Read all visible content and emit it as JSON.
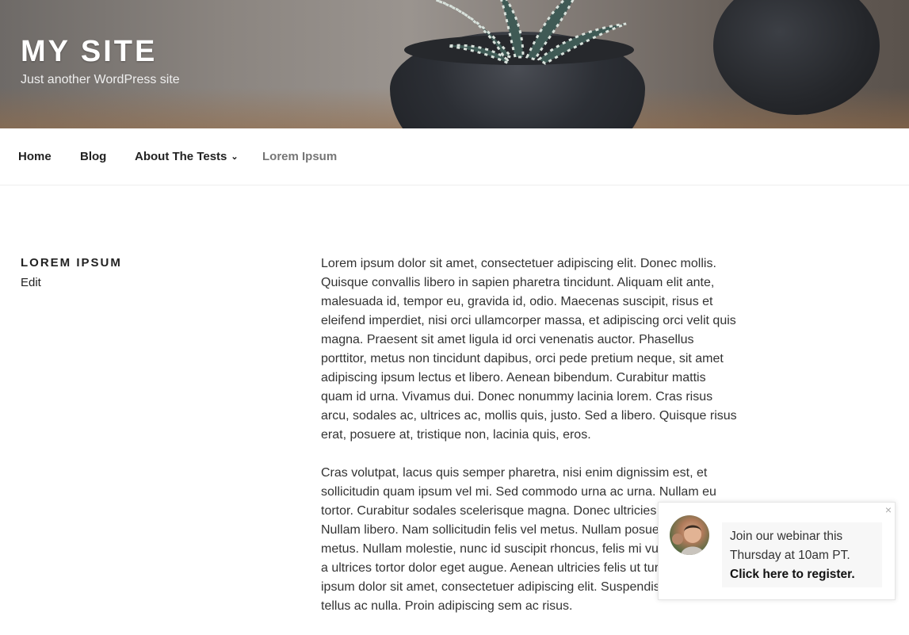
{
  "site": {
    "title": "MY SITE",
    "tagline": "Just another WordPress site"
  },
  "nav": {
    "items": [
      {
        "label": "Home"
      },
      {
        "label": "Blog"
      },
      {
        "label": "About The Tests",
        "has_submenu": true
      },
      {
        "label": "Lorem Ipsum",
        "current": true
      }
    ]
  },
  "page": {
    "title": "LOREM IPSUM",
    "edit_label": "Edit",
    "paragraphs": [
      "Lorem ipsum dolor sit amet, consectetuer adipiscing elit. Donec mollis. Quisque convallis libero in sapien pharetra tincidunt. Aliquam elit ante, malesuada id, tempor eu, gravida id, odio. Maecenas suscipit, risus et eleifend imperdiet, nisi orci ullamcorper massa, et adipiscing orci velit quis magna. Praesent sit amet ligula id orci venenatis auctor. Phasellus porttitor, metus non tincidunt dapibus, orci pede pretium neque, sit amet adipiscing ipsum lectus et libero. Aenean bibendum. Curabitur mattis quam id urna. Vivamus dui. Donec nonummy lacinia lorem. Cras risus arcu, sodales ac, ultrices ac, mollis quis, justo. Sed a libero. Quisque risus erat, posuere at, tristique non, lacinia quis, eros.",
      "Cras volutpat, lacus quis semper pharetra, nisi enim dignissim est, et sollicitudin quam ipsum vel mi. Sed commodo urna ac urna. Nullam eu tortor. Curabitur sodales scelerisque magna. Donec ultricies tristique pede. Nullam libero. Nam sollicitudin felis vel metus. Nullam posuere molestie metus. Nullam molestie, nunc id suscipit rhoncus, felis mi vulputate lacus, a ultrices tortor dolor eget augue. Aenean ultricies felis ut turpis. Lorem ipsum dolor sit amet, consectetuer adipiscing elit. Suspendisse placerat tellus ac nulla. Proin adipiscing sem ac risus."
    ]
  },
  "popup": {
    "close_glyph": "×",
    "message_line": "Join our webinar this Thursday at 10am PT.",
    "cta": "Click here to register."
  },
  "icons": {
    "chevron": "chevron-down-icon",
    "close": "close-icon"
  }
}
